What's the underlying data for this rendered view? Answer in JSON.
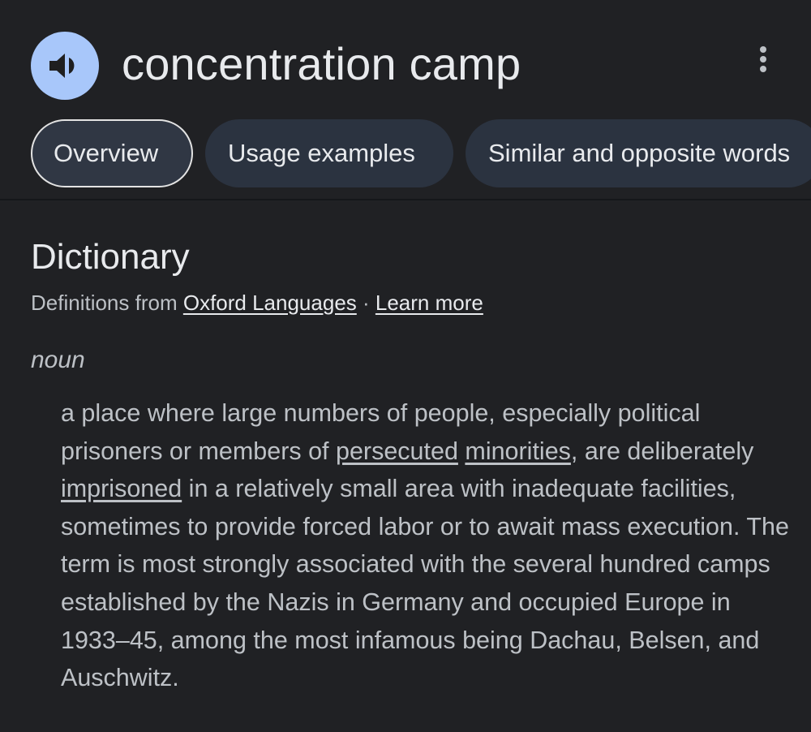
{
  "header": {
    "word": "concentration camp",
    "speaker_icon": "speaker-icon",
    "more_icon": "more-vertical-icon"
  },
  "tabs": [
    {
      "label": "Overview",
      "active": true
    },
    {
      "label": "Usage examples",
      "active": false
    },
    {
      "label": "Similar and opposite words",
      "active": false
    }
  ],
  "dictionary": {
    "title": "Dictionary",
    "source_prefix": "Definitions from ",
    "source_link": "Oxford Languages",
    "separator": " · ",
    "learn_more": "Learn more",
    "part_of_speech": "noun",
    "definition": {
      "t1": "a place where large numbers of people, especially political prisoners or members of ",
      "link1": "persecuted",
      "t2": " ",
      "link2": "minorities",
      "t3": ", are deliberately ",
      "link3": "imprisoned",
      "t4": " in a relatively small area with inadequate facilities, sometimes to provide forced labor or to await mass execution. The term is most strongly associated with the several hundred camps established by the Nazis in Germany and occupied Europe in 1933–45, among the most infamous being Dachau, Belsen, and Auschwitz."
    }
  },
  "colors": {
    "background": "#202124",
    "speaker_button": "#a8c7fa",
    "chip_background": "#2b3340",
    "text_primary": "#e8eaed",
    "text_secondary": "#bdc1c6"
  }
}
